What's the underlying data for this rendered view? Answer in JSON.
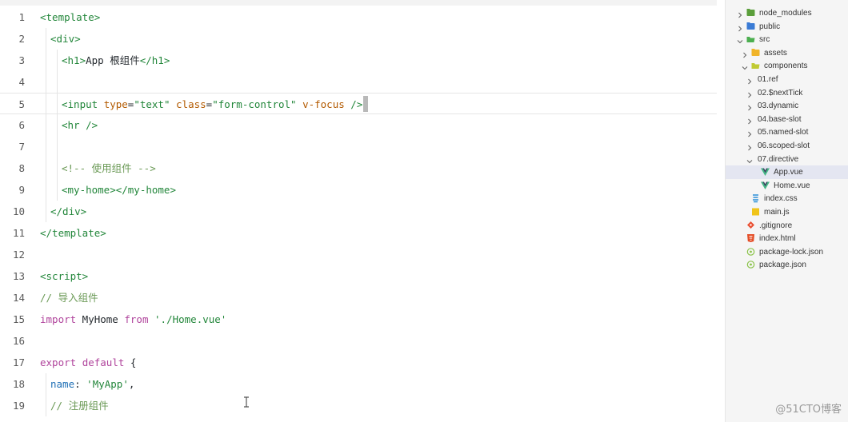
{
  "editor": {
    "lines": [
      {
        "n": "1",
        "tokens": [
          {
            "t": "<template>",
            "c": "tag"
          }
        ]
      },
      {
        "n": "2",
        "tokens": [
          {
            "t": "<div>",
            "c": "tag"
          }
        ]
      },
      {
        "n": "3",
        "tokens": [
          {
            "t": "<h1>",
            "c": "tag"
          },
          {
            "t": "App 根组件",
            "c": "name"
          },
          {
            "t": "</h1>",
            "c": "tag"
          }
        ]
      },
      {
        "n": "4",
        "tokens": []
      },
      {
        "n": "5",
        "tokens": [
          {
            "t": "<input ",
            "c": "tag"
          },
          {
            "t": "type",
            "c": "attr"
          },
          {
            "t": "=",
            "c": "pun"
          },
          {
            "t": "\"text\"",
            "c": "str"
          },
          {
            "t": " ",
            "c": "pun"
          },
          {
            "t": "class",
            "c": "attr"
          },
          {
            "t": "=",
            "c": "pun"
          },
          {
            "t": "\"form-control\"",
            "c": "str"
          },
          {
            "t": " ",
            "c": "pun"
          },
          {
            "t": "v-focus",
            "c": "attr"
          },
          {
            "t": " />",
            "c": "tag"
          }
        ]
      },
      {
        "n": "6",
        "tokens": [
          {
            "t": "<hr />",
            "c": "tag"
          }
        ]
      },
      {
        "n": "7",
        "tokens": []
      },
      {
        "n": "8",
        "tokens": [
          {
            "t": "<!-- 使用组件 -->",
            "c": "cmt"
          }
        ]
      },
      {
        "n": "9",
        "tokens": [
          {
            "t": "<my-home></my-home>",
            "c": "tag"
          }
        ]
      },
      {
        "n": "10",
        "tokens": [
          {
            "t": "</div>",
            "c": "tag"
          }
        ]
      },
      {
        "n": "11",
        "tokens": [
          {
            "t": "</template>",
            "c": "tag"
          }
        ]
      },
      {
        "n": "12",
        "tokens": []
      },
      {
        "n": "13",
        "tokens": [
          {
            "t": "<script>",
            "c": "tag"
          }
        ]
      },
      {
        "n": "14",
        "tokens": [
          {
            "t": "// 导入组件",
            "c": "cmt"
          }
        ]
      },
      {
        "n": "15",
        "tokens": [
          {
            "t": "import",
            "c": "kw"
          },
          {
            "t": " MyHome ",
            "c": "name"
          },
          {
            "t": "from",
            "c": "kw"
          },
          {
            "t": " ",
            "c": "pun"
          },
          {
            "t": "'./Home.vue'",
            "c": "str"
          }
        ]
      },
      {
        "n": "16",
        "tokens": []
      },
      {
        "n": "17",
        "tokens": [
          {
            "t": "export",
            "c": "kw"
          },
          {
            "t": " ",
            "c": "pun"
          },
          {
            "t": "default",
            "c": "kw"
          },
          {
            "t": " {",
            "c": "pun"
          }
        ]
      },
      {
        "n": "18",
        "tokens": [
          {
            "t": "name",
            "c": "obj"
          },
          {
            "t": ": ",
            "c": "pun"
          },
          {
            "t": "'MyApp'",
            "c": "str"
          },
          {
            "t": ",",
            "c": "pun"
          }
        ]
      },
      {
        "n": "19",
        "tokens": [
          {
            "t": "// 注册组件",
            "c": "cmt"
          }
        ]
      }
    ],
    "current_line": "5"
  },
  "explorer": {
    "items": [
      {
        "label": "node_modules",
        "kind": "folder-node",
        "expanded": false
      },
      {
        "label": "public",
        "kind": "folder-public",
        "expanded": false
      },
      {
        "label": "src",
        "kind": "folder-src",
        "expanded": true
      },
      {
        "label": "assets",
        "kind": "folder-assets",
        "expanded": false
      },
      {
        "label": "components",
        "kind": "folder-components",
        "expanded": true
      },
      {
        "label": "01.ref",
        "kind": "folder",
        "expanded": false
      },
      {
        "label": "02.$nextTick",
        "kind": "folder",
        "expanded": false
      },
      {
        "label": "03.dynamic",
        "kind": "folder",
        "expanded": false
      },
      {
        "label": "04.base-slot",
        "kind": "folder",
        "expanded": false
      },
      {
        "label": "05.named-slot",
        "kind": "folder",
        "expanded": false
      },
      {
        "label": "06.scoped-slot",
        "kind": "folder",
        "expanded": false
      },
      {
        "label": "07.directive",
        "kind": "folder",
        "expanded": true
      },
      {
        "label": "App.vue",
        "kind": "vue",
        "selected": true
      },
      {
        "label": "Home.vue",
        "kind": "vue"
      },
      {
        "label": "index.css",
        "kind": "css"
      },
      {
        "label": "main.js",
        "kind": "js"
      },
      {
        "label": ".gitignore",
        "kind": "git"
      },
      {
        "label": "index.html",
        "kind": "html"
      },
      {
        "label": "package-lock.json",
        "kind": "json"
      },
      {
        "label": "package.json",
        "kind": "json"
      }
    ]
  },
  "watermark": "@51CTO博客",
  "colors": {
    "tag": "#22863a",
    "attr": "#b35a00",
    "keyword": "#b0449c",
    "comment": "#6a9955",
    "selected_row": "#e4e6f1"
  }
}
